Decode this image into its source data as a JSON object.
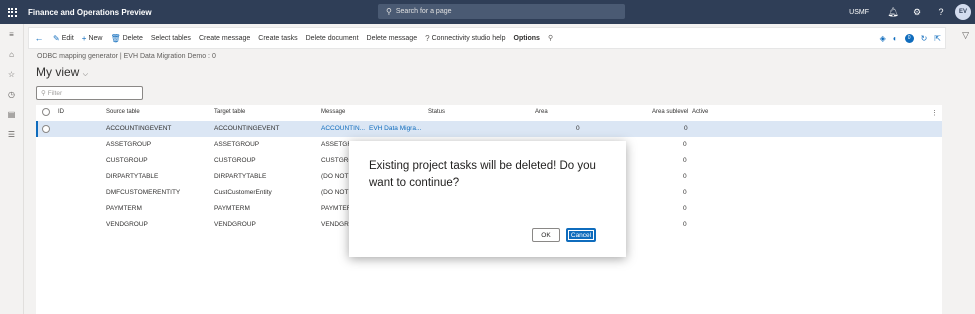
{
  "app": {
    "title": "Finance and Operations Preview",
    "search_placeholder": "Search for a page",
    "company": "USMF",
    "user_initials": "EV"
  },
  "action_pane": {
    "buttons": [
      {
        "label": "Edit",
        "icon": "edit-icon"
      },
      {
        "label": "New",
        "icon": "plus-icon"
      },
      {
        "label": "Delete",
        "icon": "trash-icon"
      },
      {
        "label": "Select tables"
      },
      {
        "label": "Create message"
      },
      {
        "label": "Create tasks"
      },
      {
        "label": "Delete document"
      },
      {
        "label": "Delete message"
      },
      {
        "label": "Connectivity studio help",
        "icon": "help-icon"
      },
      {
        "label": "Options"
      }
    ],
    "notification_count": "0"
  },
  "page": {
    "breadcrumb": "ODBC mapping generator | EVH Data Migration Demo : 0",
    "view_title": "My view",
    "filter_placeholder": "Filter"
  },
  "grid": {
    "columns": [
      "ID",
      "Source table",
      "Target table",
      "Message",
      "Status",
      "Area",
      "Area sublevel",
      "Active"
    ],
    "rows": [
      {
        "source": "ACCOUNTINGEVENT",
        "target": "ACCOUNTINGEVENT",
        "message": "ACCOUNTIN...",
        "status": "EVH Data Migra...",
        "area": "0",
        "sublevel": "0",
        "selected": true
      },
      {
        "source": "ASSETGROUP",
        "target": "ASSETGROUP",
        "message": "ASSETGRO",
        "status": "",
        "area": "",
        "sublevel": "0",
        "selected": false
      },
      {
        "source": "CUSTGROUP",
        "target": "CUSTGROUP",
        "message": "CUSTGRO",
        "status": "",
        "area": "",
        "sublevel": "0",
        "selected": false
      },
      {
        "source": "DIRPARTYTABLE",
        "target": "DIRPARTYTABLE",
        "message": "(DO NOT",
        "status": "",
        "area": "",
        "sublevel": "0",
        "selected": false
      },
      {
        "source": "DMFCUSTOMERENTITY",
        "target": "CustCustomerEntity",
        "message": "(DO NOT",
        "status": "",
        "area": "",
        "sublevel": "0",
        "selected": false
      },
      {
        "source": "PAYMTERM",
        "target": "PAYMTERM",
        "message": "PAYMTER",
        "status": "",
        "area": "",
        "sublevel": "0",
        "selected": false
      },
      {
        "source": "VENDGROUP",
        "target": "VENDGROUP",
        "message": "VENDGRO",
        "status": "",
        "area": "",
        "sublevel": "0",
        "selected": false
      }
    ]
  },
  "dialog": {
    "message": "Existing project tasks will be deleted! Do you want to continue?",
    "ok_label": "OK",
    "cancel_label": "Cancel"
  }
}
